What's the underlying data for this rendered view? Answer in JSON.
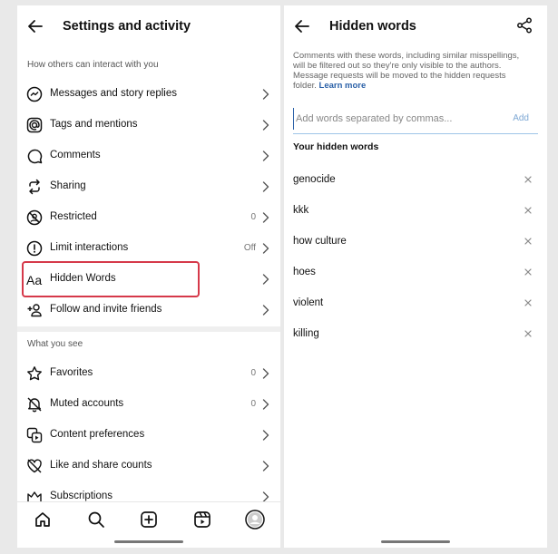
{
  "left": {
    "title": "Settings and activity",
    "section1": "How others can interact with you",
    "items1": [
      {
        "label": "Messages and story replies",
        "value": "",
        "icon": "messenger-icon"
      },
      {
        "label": "Tags and mentions",
        "value": "",
        "icon": "at-sign-icon"
      },
      {
        "label": "Comments",
        "value": "",
        "icon": "comment-icon"
      },
      {
        "label": "Sharing",
        "value": "",
        "icon": "share-arrows-icon"
      },
      {
        "label": "Restricted",
        "value": "0",
        "icon": "restricted-icon"
      },
      {
        "label": "Limit interactions",
        "value": "Off",
        "icon": "alert-circle-icon"
      },
      {
        "label": "Hidden Words",
        "value": "",
        "icon": "text-aa-icon"
      },
      {
        "label": "Follow and invite friends",
        "value": "",
        "icon": "add-person-icon"
      }
    ],
    "section2": "What you see",
    "items2": [
      {
        "label": "Favorites",
        "value": "0",
        "icon": "star-icon"
      },
      {
        "label": "Muted accounts",
        "value": "0",
        "icon": "muted-bell-icon"
      },
      {
        "label": "Content preferences",
        "value": "",
        "icon": "content-prefs-icon"
      },
      {
        "label": "Like and share counts",
        "value": "",
        "icon": "heart-crossed-icon"
      },
      {
        "label": "Subscriptions",
        "value": "",
        "icon": "crown-icon"
      }
    ],
    "highlight_color": "#d6394a"
  },
  "right": {
    "title": "Hidden words",
    "description": "Comments with these words, including similar misspellings, will be filtered out so they're only visible to the authors. Message requests will be moved to the hidden requests folder.",
    "learn_more": "Learn more",
    "input_placeholder": "Add words separated by commas...",
    "add_label": "Add",
    "subhead": "Your hidden words",
    "words": [
      "genocide",
      "kkk",
      "how culture",
      "hoes",
      "violent",
      "killing"
    ]
  }
}
